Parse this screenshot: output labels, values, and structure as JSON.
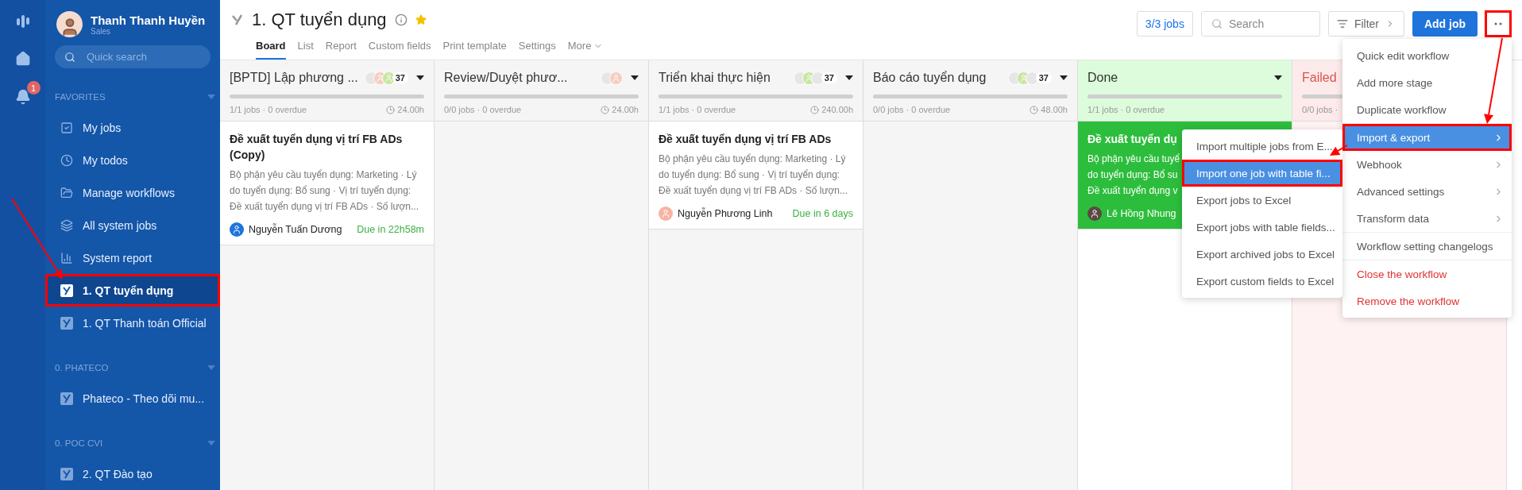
{
  "rail": {
    "notification_badge": "1"
  },
  "user": {
    "name": "Thanh Thanh Huyền",
    "role": "Sales"
  },
  "sidebar": {
    "search": {
      "placeholder": "Quick search"
    },
    "sections": [
      {
        "title": "FAVORITES",
        "items": [
          {
            "label": "My jobs",
            "kind": "check",
            "selected": false,
            "annotated": false
          },
          {
            "label": "My todos",
            "kind": "clock",
            "selected": false,
            "annotated": false
          },
          {
            "label": "Manage workflows",
            "kind": "folder",
            "selected": false,
            "annotated": false
          },
          {
            "label": "All system jobs",
            "kind": "layers",
            "selected": false,
            "annotated": false
          },
          {
            "label": "System report",
            "kind": "chart",
            "selected": false,
            "annotated": false
          },
          {
            "label": "1. QT tuyển dụng",
            "kind": "workflow",
            "selected": true,
            "annotated": true
          },
          {
            "label": "1. QT Thanh toán Official",
            "kind": "workflow",
            "selected": false,
            "annotated": false
          }
        ]
      },
      {
        "title": "0. PHATECO",
        "items": [
          {
            "label": "Phateco - Theo dõi mu...",
            "kind": "workflow",
            "selected": false,
            "annotated": false
          }
        ]
      },
      {
        "title": "0. POC CVI",
        "items": [
          {
            "label": "2. QT Đào tạo",
            "kind": "workflow",
            "selected": false,
            "annotated": false
          }
        ]
      }
    ]
  },
  "header": {
    "title": "1. QT tuyển dụng",
    "starred": true,
    "tabs": [
      {
        "label": "Board",
        "selected": true
      },
      {
        "label": "List",
        "selected": false
      },
      {
        "label": "Report",
        "selected": false
      },
      {
        "label": "Custom fields",
        "selected": false
      },
      {
        "label": "Print template",
        "selected": false
      },
      {
        "label": "Settings",
        "selected": false
      },
      {
        "label": "More",
        "selected": false
      }
    ],
    "jobs_count": "3/3 jobs",
    "search": {
      "placeholder": "Search"
    },
    "filter": "Filter",
    "add_job": "Add job",
    "more_annotated": true
  },
  "columns": [
    {
      "kind": "stage",
      "title": "[BPTD] Lập phương ...",
      "avatars": [
        {
          "kind": "blank"
        },
        {
          "kind": "person"
        },
        {
          "kind": "user"
        }
      ],
      "count": "37",
      "stats": "1/1 jobs · 0 overdue",
      "hours": "24.00h",
      "cards": [
        {
          "title": "Đề xuất tuyển dụng vị trí FB ADs (Copy)",
          "lines": [
            "Bộ phận yêu cầu tuyển dụng: Marketing · Lý",
            "do tuyển dụng: Bổ sung · Vị trí tuyển dụng:",
            "Đề xuất tuyển dụng vị trí FB ADs · Số lượn..."
          ],
          "assignee": "Nguyễn Tuấn Dương",
          "avatar": {
            "kind": "logo"
          },
          "due": "Due in 22h58m"
        }
      ]
    },
    {
      "kind": "stage",
      "title": "Review/Duyệt phươ...",
      "avatars": [
        {
          "kind": "blank"
        },
        {
          "kind": "person"
        }
      ],
      "stats": "0/0 jobs · 0 overdue",
      "hours": "24.00h"
    },
    {
      "kind": "stage",
      "title": "Triển khai thực hiện",
      "avatars": [
        {
          "kind": "blank"
        },
        {
          "kind": "user"
        },
        {
          "kind": "blank"
        }
      ],
      "count": "37",
      "stats": "1/1 jobs · 0 overdue",
      "hours": "240.00h",
      "cards": [
        {
          "title": "Đề xuất tuyển dụng vị trí FB ADs",
          "lines": [
            "Bộ phận yêu cầu tuyển dụng: Marketing · Lý",
            "do tuyển dụng: Bổ sung · Vị trí tuyển dụng:",
            "Đề xuất tuyển dụng vị trí FB ADs · Số lượn..."
          ],
          "assignee": "Nguyễn Phương Linh",
          "avatar": {
            "kind": "user"
          },
          "due": "Due in 6 days"
        }
      ]
    },
    {
      "kind": "stage",
      "title": "Báo cáo tuyển dụng",
      "avatars": [
        {
          "kind": "blank"
        },
        {
          "kind": "user"
        },
        {
          "kind": "blank"
        }
      ],
      "count": "37",
      "stats": "0/0 jobs · 0 overdue",
      "hours": "48.00h"
    },
    {
      "kind": "done",
      "title": "Done",
      "stats": "1/1 jobs · 0 overdue",
      "cards": [
        {
          "title": "Đề xuất tuyển dụ",
          "lines": [
            "Bộ phận yêu cầu tuyể",
            "do tuyển dụng: Bổ su",
            "Đề xuất tuyển dụng v"
          ],
          "assignee": "Lê Hồng Nhung",
          "avatar": {
            "kind": "person"
          }
        }
      ]
    },
    {
      "kind": "failed",
      "title": "Failed",
      "stats": "0/0 jobs ·"
    }
  ],
  "menu": {
    "groups": [
      [
        {
          "label": "Quick edit workflow",
          "submenu": false,
          "danger": false,
          "selected": false,
          "annotated": false
        },
        {
          "label": "Add more stage",
          "submenu": false,
          "danger": false,
          "selected": false,
          "annotated": false
        },
        {
          "label": "Duplicate workflow",
          "submenu": false,
          "danger": false,
          "selected": false,
          "annotated": false
        }
      ],
      [
        {
          "label": "Import & export",
          "submenu": true,
          "danger": false,
          "selected": true,
          "annotated": true
        },
        {
          "label": "Webhook",
          "submenu": true,
          "danger": false,
          "selected": false,
          "annotated": false
        },
        {
          "label": "Advanced settings",
          "submenu": true,
          "danger": false,
          "selected": false,
          "annotated": false
        },
        {
          "label": "Transform data",
          "submenu": true,
          "danger": false,
          "selected": false,
          "annotated": false
        }
      ],
      [
        {
          "label": "Workflow setting changelogs",
          "submenu": false,
          "danger": false,
          "selected": false,
          "annotated": false
        }
      ],
      [
        {
          "label": "Close the workflow",
          "submenu": false,
          "danger": true,
          "selected": false,
          "annotated": false
        },
        {
          "label": "Remove the workflow",
          "submenu": false,
          "danger": true,
          "selected": false,
          "annotated": false
        }
      ]
    ]
  },
  "submenu": {
    "groups": [
      [
        {
          "label": "Import multiple jobs from E...",
          "selected": false,
          "annotated": false
        },
        {
          "label": "Import one job with table fi...",
          "selected": true,
          "annotated": true
        }
      ],
      [
        {
          "label": "Export jobs to Excel",
          "selected": false,
          "annotated": false
        },
        {
          "label": "Export jobs with table fields...",
          "selected": false,
          "annotated": false
        },
        {
          "label": "Export archived jobs to Excel",
          "selected": false,
          "annotated": false
        },
        {
          "label": "Export custom fields to Excel",
          "selected": false,
          "annotated": false
        }
      ]
    ]
  }
}
